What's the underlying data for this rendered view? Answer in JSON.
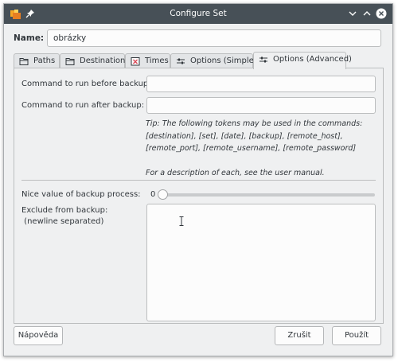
{
  "window": {
    "title": "Configure Set"
  },
  "titlebar": {
    "icons": [
      "app-icon",
      "pin-icon",
      "chevron-down-icon",
      "chevron-up-icon",
      "close-icon"
    ]
  },
  "name": {
    "label": "Name:",
    "value": "obrázky"
  },
  "tabs": [
    {
      "label": "Paths",
      "icon": "folder-icon",
      "active": false
    },
    {
      "label": "Destination",
      "icon": "folder-icon",
      "active": false
    },
    {
      "label": "Times",
      "icon": "calendar-icon",
      "active": false
    },
    {
      "label": "Options (Simple)",
      "icon": "sliders-icon",
      "active": false
    },
    {
      "label": "Options (Advanced)",
      "icon": "sliders-icon",
      "active": true
    }
  ],
  "advanced": {
    "before_label": "Command to run before backup:",
    "before_value": "",
    "after_label": "Command to run after backup:",
    "after_value": "",
    "tip_line1": "Tip: The following tokens may be used in the commands:",
    "tip_line2": "[destination], [set], [date], [backup], [remote_host],",
    "tip_line3": "[remote_port], [remote_username], [remote_password]",
    "tip_line4": "For a description of each, see the user manual.",
    "nice_label": "Nice value of backup process:",
    "nice_value": "0",
    "nice_level": 0,
    "exclude_label_line1": "Exclude from backup:",
    "exclude_label_line2": " (newline separated)",
    "exclude_value": ""
  },
  "buttons": {
    "help": "Nápověda",
    "cancel": "Zrušit",
    "apply": "Použít"
  },
  "colors": {
    "titlebar": "#475057",
    "window_bg": "#eff0f1",
    "field_bg": "#fcfcfc",
    "close_red": "#da4453"
  }
}
